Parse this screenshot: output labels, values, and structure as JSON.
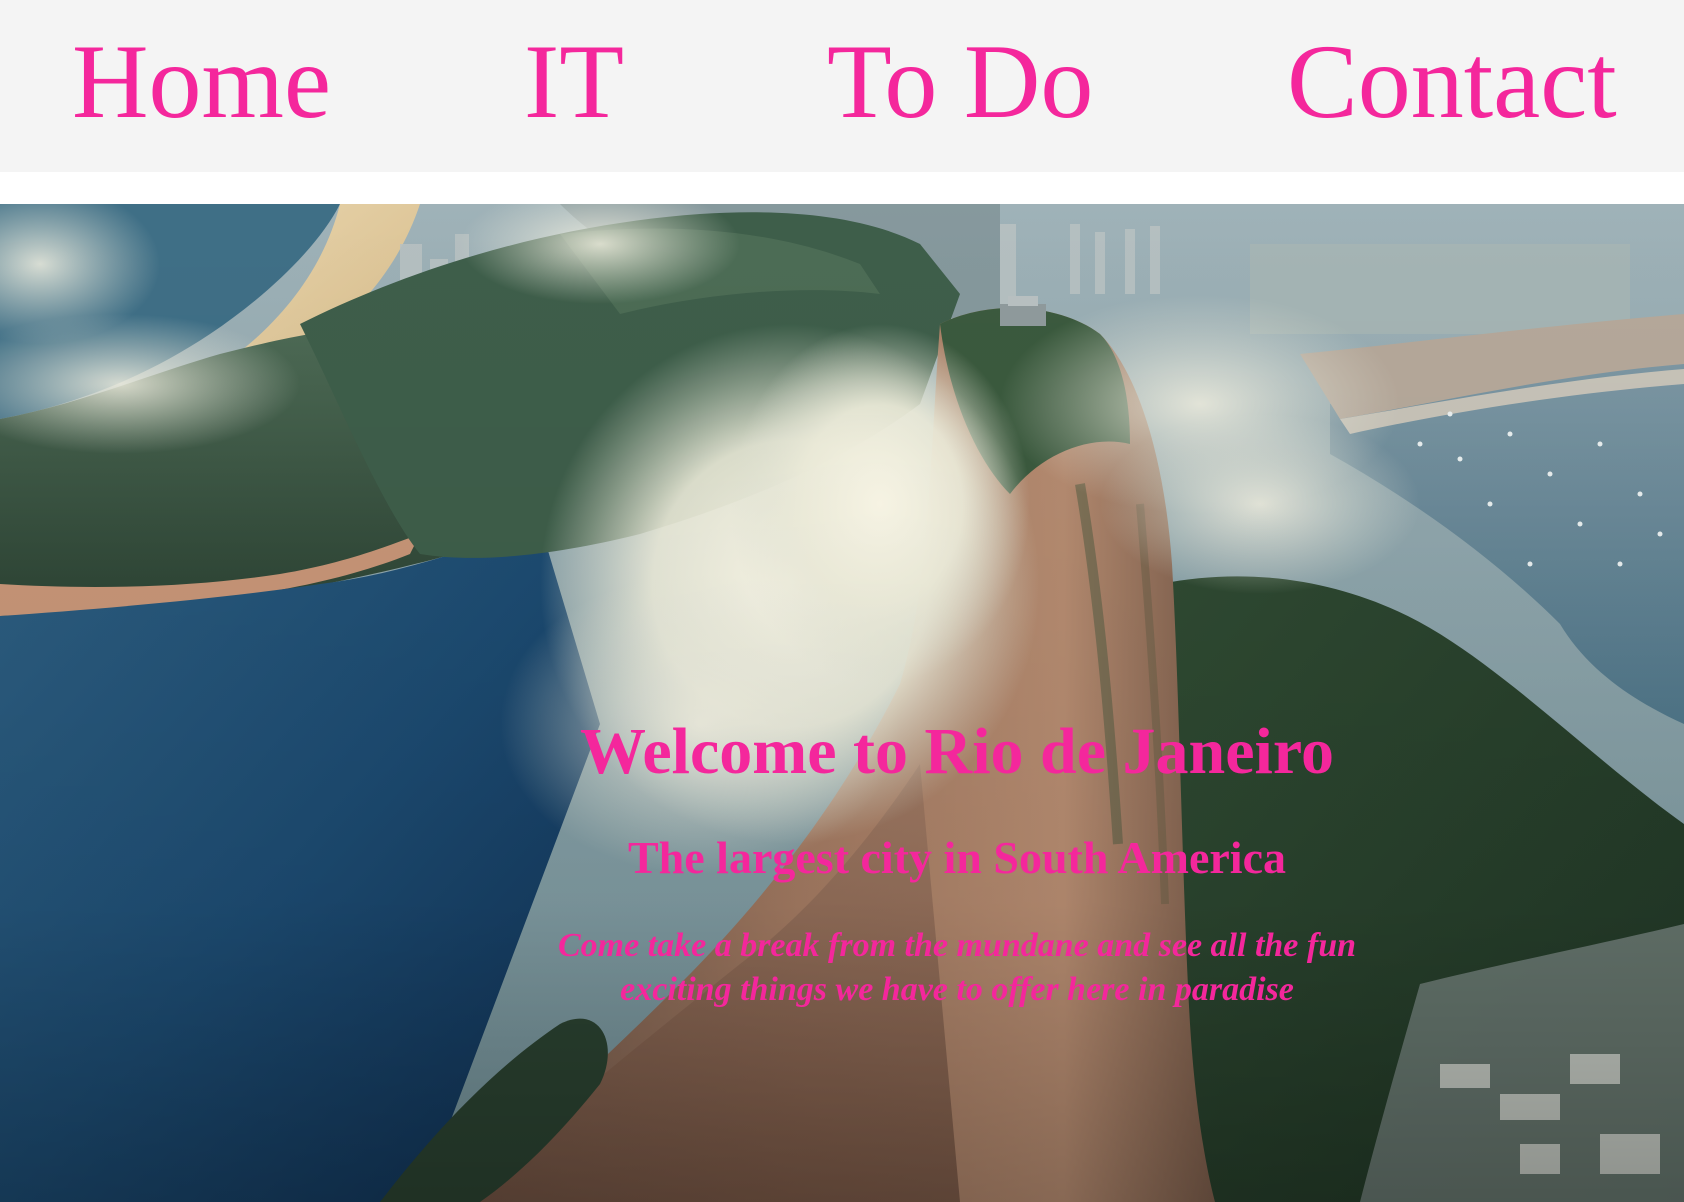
{
  "nav": {
    "items": [
      {
        "label": "Home"
      },
      {
        "label": "IT"
      },
      {
        "label": "To Do"
      },
      {
        "label": "Contact"
      }
    ]
  },
  "hero": {
    "title": "Welcome to Rio de Janeiro",
    "subtitle": "The largest city in South America",
    "tagline": "Come take a break from the mundane and see all the fun exciting things we have to offer here in paradise"
  },
  "colors": {
    "accent": "#f4279c",
    "nav_background": "#f4f4f4",
    "page_background": "#ffffff"
  }
}
